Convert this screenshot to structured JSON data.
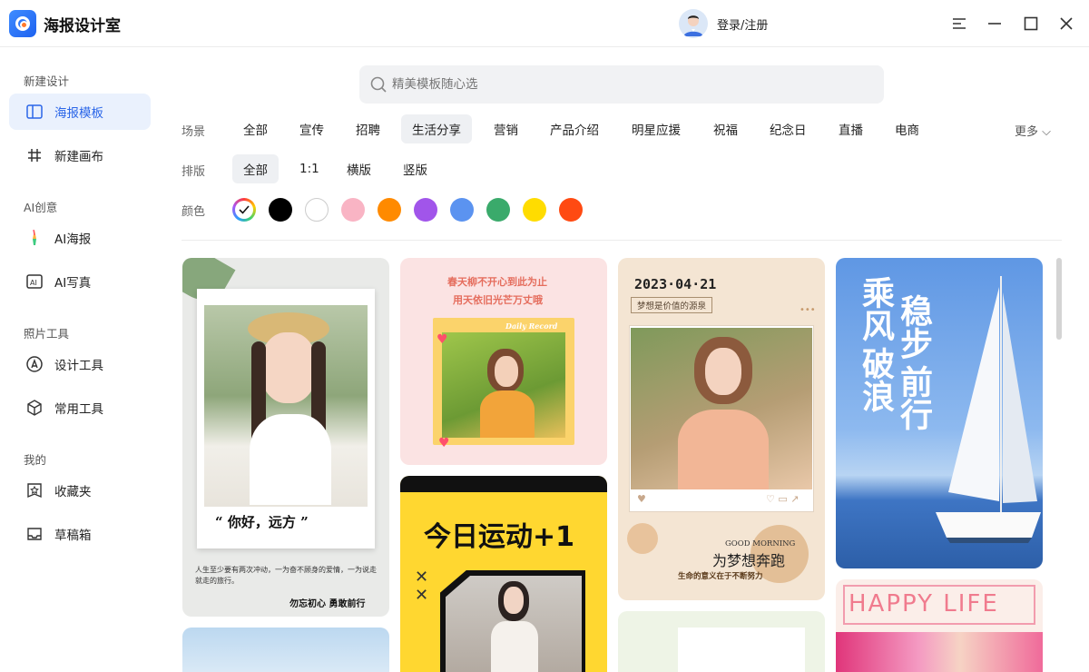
{
  "app": {
    "title": "海报设计室",
    "login": "登录/注册"
  },
  "sidebar": {
    "sections": {
      "new_design": "新建设计",
      "ai_creative": "AI创意",
      "photo_tools": "照片工具",
      "mine": "我的"
    },
    "items": [
      {
        "label": "海报模板",
        "icon": "poster-template-icon",
        "active": true
      },
      {
        "label": "新建画布",
        "icon": "canvas-grid-icon"
      },
      {
        "label": "AI海报",
        "icon": "ai-brush-icon"
      },
      {
        "label": "AI写真",
        "icon": "ai-photo-icon"
      },
      {
        "label": "设计工具",
        "icon": "design-pen-icon"
      },
      {
        "label": "常用工具",
        "icon": "cube-icon"
      },
      {
        "label": "收藏夹",
        "icon": "star-folder-icon"
      },
      {
        "label": "草稿箱",
        "icon": "draft-tray-icon"
      }
    ]
  },
  "search": {
    "placeholder": "精美模板随心选"
  },
  "filters": {
    "scene_label": "场景",
    "scenes": [
      "全部",
      "宣传",
      "招聘",
      "生活分享",
      "营销",
      "产品介绍",
      "明星应援",
      "祝福",
      "纪念日",
      "直播",
      "电商"
    ],
    "scene_selected": "生活分享",
    "more": "更多",
    "layout_label": "排版",
    "layouts": [
      "全部",
      "1:1",
      "横版",
      "竖版"
    ],
    "layout_selected": "全部",
    "color_label": "颜色",
    "colors": [
      "#000000",
      "#ffffff",
      "#f9b4c4",
      "#ff8a00",
      "#a155ea",
      "#5b93f0",
      "#3aaa6b",
      "#ffdc00",
      "#ff4a12"
    ]
  },
  "cards": {
    "c1_caption": "“ 你好，远方 ”",
    "c1_lines": "人生至少要有两次冲动，一为奋不顾身的爱情，一为说走就走的旅行。",
    "c1_sign": "勿忘初心 勇敢前行",
    "c2_line1": "春天柳不开心到此为止",
    "c2_line2": "用天依旧光芒万丈哦",
    "c2_tag": "Daily Record",
    "c3_title": "今日运动+1",
    "c4_date": "2023·04·21",
    "c4_sub": "梦想是价值的源泉",
    "c4_gm": "GOOD MORNING",
    "c4_big": "为梦想奔跑",
    "c4_foot": "生命的意义在于不断努力",
    "c5_t1": "乘风",
    "c5_t2": "破浪",
    "c5_t3": "稳步",
    "c5_t4": "前行",
    "c6_title": "HAPPY LIFE"
  }
}
